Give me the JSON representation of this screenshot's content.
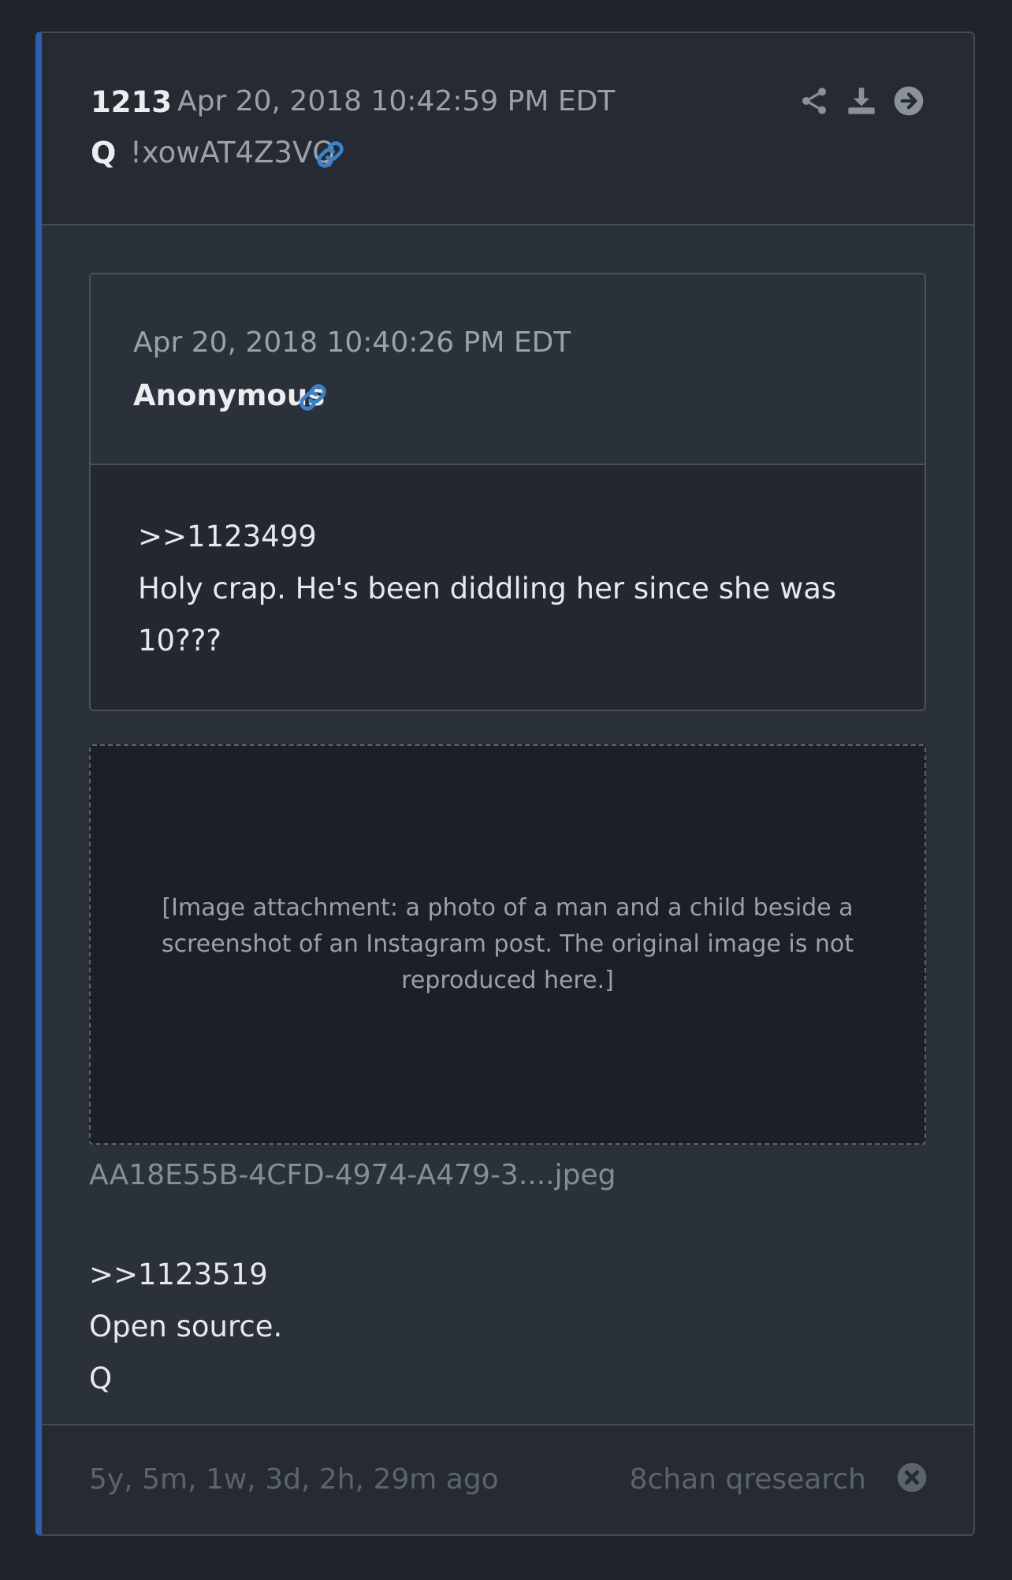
{
  "post": {
    "number": "1213",
    "date": "Apr 20, 2018 10:42:59 PM EDT",
    "author": "Q",
    "tripcode": "!xowAT4Z3VQ"
  },
  "quoted": {
    "date": "Apr 20, 2018 10:40:26 PM EDT",
    "author": "Anonymous",
    "lines": [
      ">>1123499",
      "Holy crap. He's been diddling her since she was",
      "10???"
    ]
  },
  "attachment": {
    "placeholder": "[Image attachment: a photo of a man and a child beside a screenshot of an Instagram post. The original image is not reproduced here.]",
    "filename": "AA18E55B-4CFD-4974-A479-3....jpeg"
  },
  "body": {
    "lines": [
      ">>1123519",
      "Open source.",
      "Q"
    ]
  },
  "footer": {
    "elapsed": "5y, 5m, 1w, 3d, 2h, 29m ago",
    "source": "8chan qresearch"
  },
  "colors": {
    "accent": "#2d5fb0",
    "link": "#3b82c8"
  },
  "icons": [
    "share-icon",
    "download-icon",
    "arrow-right-icon",
    "link-icon",
    "close-icon"
  ]
}
